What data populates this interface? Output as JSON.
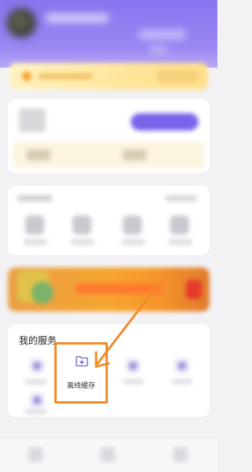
{
  "services": {
    "title": "我的服务",
    "highlighted": {
      "label": "离线缓存",
      "icon": "folder-download-icon"
    }
  },
  "colors": {
    "header_purple": "#8a74f0",
    "accent_orange": "#f08c2a",
    "vip_yellow": "#ffe59a",
    "action_purple": "#7a63e9"
  }
}
